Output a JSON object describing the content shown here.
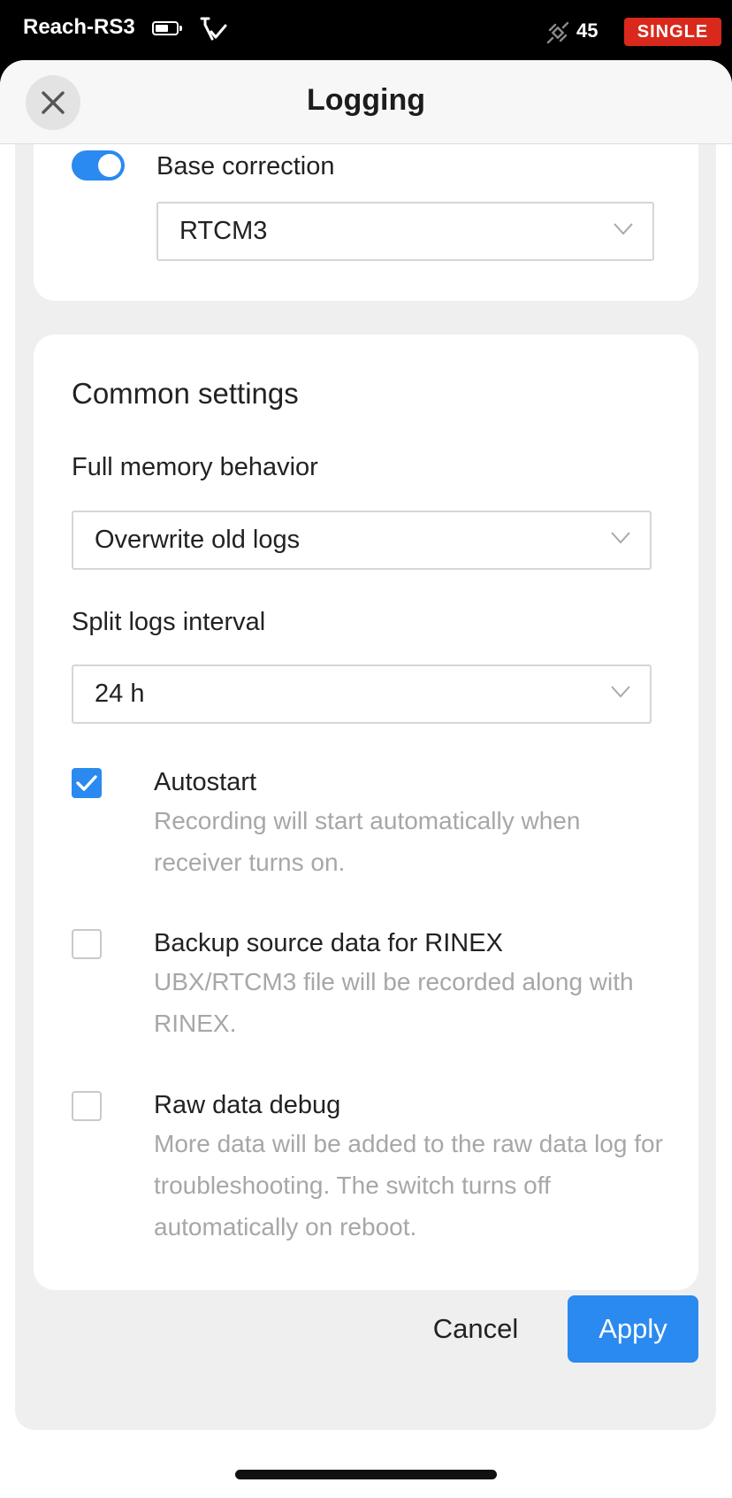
{
  "status_bar": {
    "device_name": "Reach-RS3",
    "satellite_count": "45",
    "solution_status": "SINGLE",
    "solution_color": "#d9281c"
  },
  "header": {
    "title": "Logging"
  },
  "base_correction": {
    "label": "Base correction",
    "enabled": true,
    "format": "RTCM3"
  },
  "common_settings": {
    "title": "Common settings",
    "full_memory_label": "Full memory behavior",
    "full_memory_value": "Overwrite old logs",
    "split_interval_label": "Split logs interval",
    "split_interval_value": "24 h",
    "options": [
      {
        "title": "Autostart",
        "description": "Recording will start automatically when receiver turns on.",
        "checked": true
      },
      {
        "title": "Backup source data for RINEX",
        "description": "UBX/RTCM3 file will be recorded along with RINEX.",
        "checked": false
      },
      {
        "title": "Raw data debug",
        "description": "More data will be added to the raw data log for troubleshooting. The switch turns off automatically on reboot.",
        "checked": false
      }
    ]
  },
  "actions": {
    "cancel": "Cancel",
    "apply": "Apply"
  },
  "colors": {
    "accent": "#2a8af0"
  }
}
